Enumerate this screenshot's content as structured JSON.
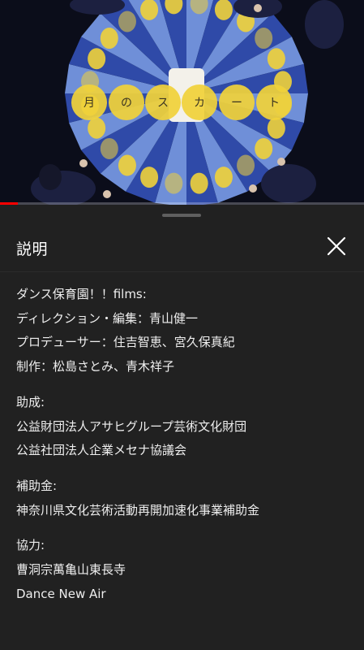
{
  "video": {
    "caption_chars": [
      "月",
      "の",
      "ス",
      "カ",
      "ー",
      "ト"
    ],
    "progress": 0.05,
    "colors": {
      "accent": "#ff0000",
      "moon": "#f0d23a",
      "skirt_light": "#6f8fd8",
      "skirt_dark": "#2f4aa8"
    }
  },
  "sheet": {
    "title": "説明"
  },
  "description": {
    "credits": [
      "ダンス保育園！！films:",
      "ディレクション・編集：青山健一",
      "プロデューサー：住吉智恵、宮久保真紀",
      "制作：松島さとみ、青木祥子"
    ],
    "support_heading": "助成:",
    "support": [
      "公益財団法人アサヒグループ芸術文化財団",
      "公益社団法人企業メセナ協議会"
    ],
    "subsidy_heading": "補助金:",
    "subsidy": [
      "神奈川県文化芸術活動再開加速化事業補助金"
    ],
    "cooperation_heading": "協力:",
    "cooperation": [
      "曹洞宗萬亀山東長寺",
      "Dance New Air"
    ]
  }
}
